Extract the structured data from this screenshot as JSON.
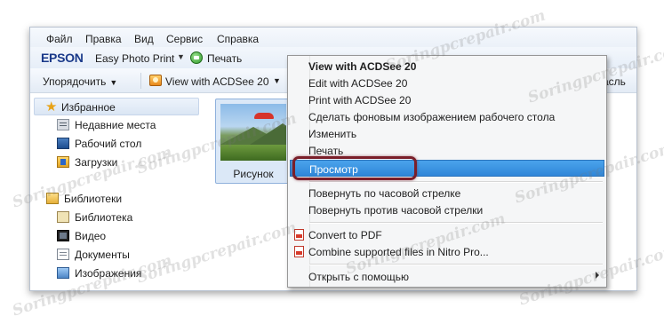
{
  "menubar": {
    "items": [
      "Файл",
      "Правка",
      "Вид",
      "Сервис",
      "Справка"
    ]
  },
  "epson_bar": {
    "logo": "EPSON",
    "app_name": "Easy Photo Print",
    "print_label": "Печать",
    "print_icon": "print-green-circle-icon"
  },
  "toolbar": {
    "organize_label": "Упорядочить",
    "view_label": "View with ACDSee 20",
    "right_partial": "асль"
  },
  "nav": {
    "favorites": "Избранное",
    "recent": "Недавние места",
    "desktop": "Рабочий стол",
    "downloads": "Загрузки",
    "libraries": "Библиотеки",
    "library": "Библиотека",
    "video": "Видео",
    "documents": "Документы",
    "images": "Изображения"
  },
  "file": {
    "label": "Рисунок"
  },
  "context_menu": {
    "items": [
      "View with ACDSee 20",
      "Edit with ACDSee 20",
      "Print with ACDSee 20",
      "Сделать фоновым изображением рабочего стола",
      "Изменить",
      "Печать",
      "Просмотр",
      "Повернуть по часовой стрелке",
      "Повернуть против часовой стрелки",
      "Convert to PDF",
      "Combine supported files in Nitro Pro...",
      "Открыть с помощью"
    ],
    "highlighted": "Просмотр"
  },
  "watermark": "Soringpcrepair.com",
  "colors": {
    "highlight": "#3a8fdd",
    "callout_ring": "#7a1f2a"
  }
}
